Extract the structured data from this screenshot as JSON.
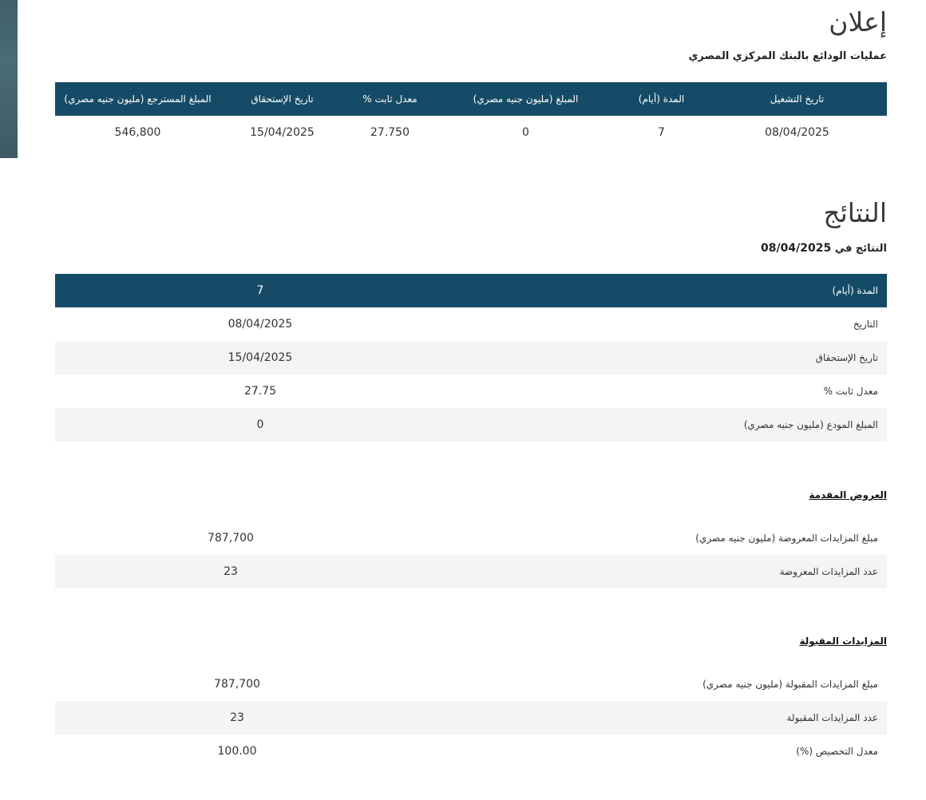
{
  "announcement": {
    "title": "إعلان",
    "subtitle": "عمليات الودائع بالبنك المركزي المصري",
    "table": {
      "headers": [
        "تاريخ التشغيل",
        "المدة (أيام)",
        "المبلغ (مليون جنيه مصري)",
        "معدل ثابت %",
        "تاريخ الإستحقاق",
        "المبلغ المسترجع (مليون جنيه مصري)"
      ],
      "row": [
        "08/04/2025",
        "7",
        "0",
        "27.750",
        "15/04/2025",
        "546,800"
      ]
    }
  },
  "results": {
    "title": "النتائج",
    "subtitle_prefix": "النتائج في",
    "subtitle_date": "08/04/2025",
    "summary": [
      {
        "label": "المدة (أيام)",
        "value": "7"
      },
      {
        "label": "التاريخ",
        "value": "08/04/2025"
      },
      {
        "label": "تاريخ الإستحقاق",
        "value": "15/04/2025"
      },
      {
        "label": "معدل ثابت %",
        "value": "27.75"
      },
      {
        "label": "المبلغ المودع (مليون جنيه مصري)",
        "value": "0"
      }
    ]
  },
  "offers": {
    "title": "العروض المقدمة",
    "rows": [
      {
        "label": "مبلغ المزايدات المعروضة (مليون جنيه مصري)",
        "value": "787,700"
      },
      {
        "label": "عدد المزايدات المعروضة",
        "value": "23"
      }
    ]
  },
  "accepted": {
    "title": "المزايدات المقبولة",
    "rows": [
      {
        "label": "مبلغ المزايدات المقبولة (مليون جنيه مصري)",
        "value": "787,700"
      },
      {
        "label": "عدد المزايدات المقبولة",
        "value": "23"
      },
      {
        "label": "معدل التخصيص (%)",
        "value": "100.00"
      }
    ]
  }
}
